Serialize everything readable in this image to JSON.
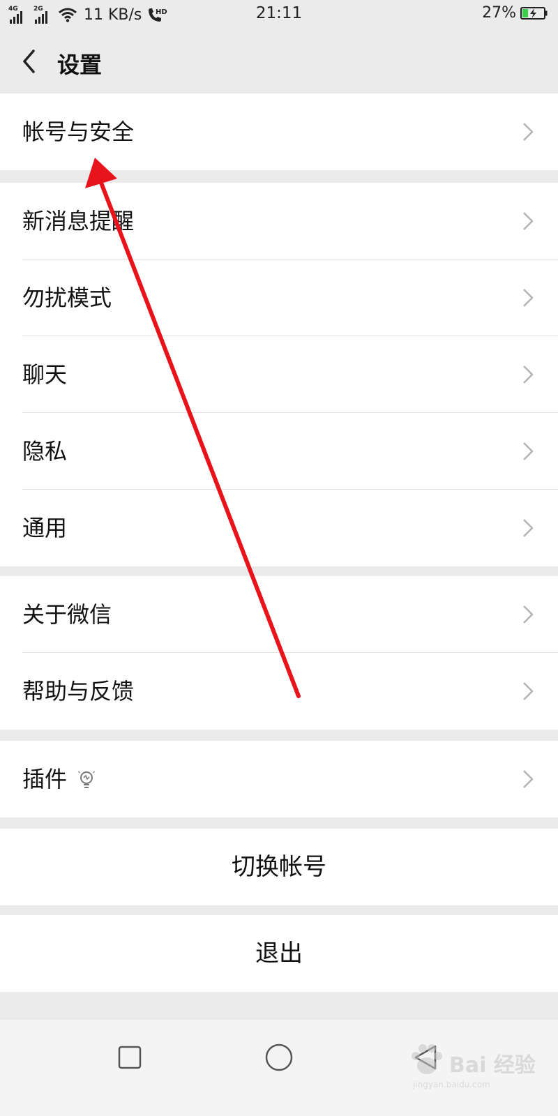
{
  "status_bar": {
    "signal1_tag": "4G",
    "signal2_tag": "2G",
    "net_speed": "11 KB/s",
    "hd_tag": "HD",
    "time": "21:11",
    "battery_pct": "27%",
    "battery_level": 0.27,
    "battery_charging": true
  },
  "header": {
    "title": "设置",
    "back_icon": "chevron-left-icon"
  },
  "groups": [
    {
      "items": [
        {
          "label": "帐号与安全",
          "icon": "chevron-right-icon"
        }
      ]
    },
    {
      "items": [
        {
          "label": "新消息提醒",
          "icon": "chevron-right-icon"
        },
        {
          "label": "勿扰模式",
          "icon": "chevron-right-icon"
        },
        {
          "label": "聊天",
          "icon": "chevron-right-icon"
        },
        {
          "label": "隐私",
          "icon": "chevron-right-icon"
        },
        {
          "label": "通用",
          "icon": "chevron-right-icon"
        }
      ]
    },
    {
      "items": [
        {
          "label": "关于微信",
          "icon": "chevron-right-icon"
        },
        {
          "label": "帮助与反馈",
          "icon": "chevron-right-icon"
        }
      ]
    },
    {
      "items": [
        {
          "label": "插件",
          "icon": "chevron-right-icon",
          "badge_icon": "lightbulb-icon"
        }
      ]
    }
  ],
  "actions": {
    "switch_account": "切换帐号",
    "logout": "退出"
  },
  "nav_bar": {
    "buttons": [
      "recent-apps-icon",
      "home-icon",
      "back-icon"
    ]
  },
  "watermark": {
    "text": "Bai 经验",
    "subtext": "jingyan.baidu.com"
  },
  "colors": {
    "background": "#ebebeb",
    "card": "#ffffff",
    "annotation_arrow": "#e8141c",
    "battery_fill": "#3ccf4e"
  }
}
